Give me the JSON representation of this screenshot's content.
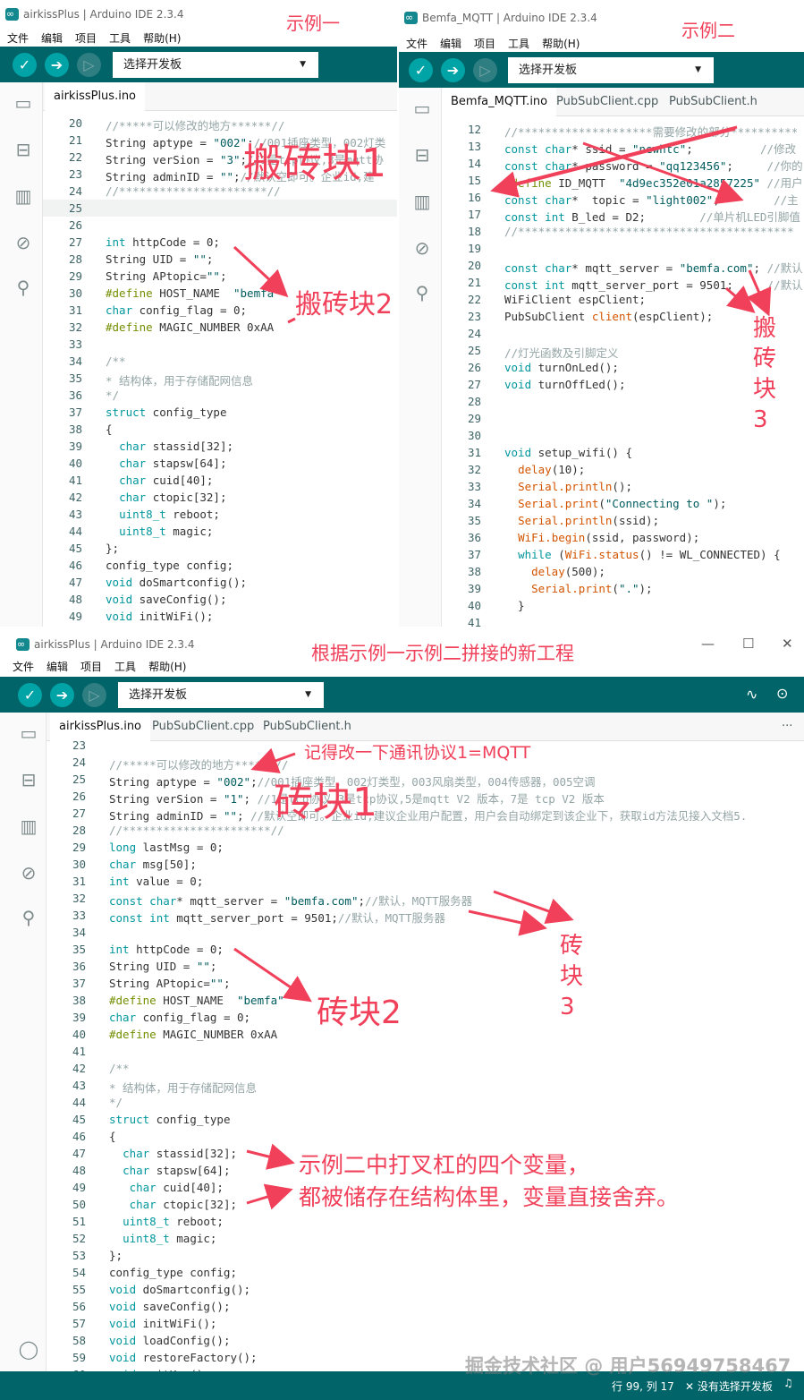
{
  "window1": {
    "title": "airkissPlus | Arduino IDE 2.3.4",
    "annotation": "示例一",
    "menus": [
      "文件",
      "编辑",
      "项目",
      "工具",
      "帮助(H)"
    ],
    "board_label": "选择开发板",
    "tabs": [
      "airkissPlus.ino"
    ],
    "lines": [
      {
        "n": "20",
        "t": "//*****可以修改的地方******//"
      },
      {
        "n": "21",
        "t": "String aptype = \"002\";//001插座类型，002灯类"
      },
      {
        "n": "22",
        "t": "String verSion = \"3\";//1是tcp协议,3是mqtt协"
      },
      {
        "n": "23",
        "t": "String adminID = \"\";//默认空即可。企业id,建"
      },
      {
        "n": "24",
        "t": "//**********************//"
      },
      {
        "n": "25",
        "t": ""
      },
      {
        "n": "26",
        "t": ""
      },
      {
        "n": "27",
        "t": "int httpCode = 0;"
      },
      {
        "n": "28",
        "t": "String UID = \"\";"
      },
      {
        "n": "29",
        "t": "String APtopic=\"\";"
      },
      {
        "n": "30",
        "t": "#define HOST_NAME  \"bemfa\""
      },
      {
        "n": "31",
        "t": "char config_flag = 0;"
      },
      {
        "n": "32",
        "t": "#define MAGIC_NUMBER 0xAA"
      },
      {
        "n": "33",
        "t": ""
      },
      {
        "n": "34",
        "t": "/**"
      },
      {
        "n": "35",
        "t": "* 结构体，用于存储配网信息"
      },
      {
        "n": "36",
        "t": "*/"
      },
      {
        "n": "37",
        "t": "struct config_type"
      },
      {
        "n": "38",
        "t": "{"
      },
      {
        "n": "39",
        "t": "  char stassid[32];"
      },
      {
        "n": "40",
        "t": "  char stapsw[64];"
      },
      {
        "n": "41",
        "t": "  char cuid[40];"
      },
      {
        "n": "42",
        "t": "  char ctopic[32];"
      },
      {
        "n": "43",
        "t": "  uint8_t reboot;"
      },
      {
        "n": "44",
        "t": "  uint8_t magic;"
      },
      {
        "n": "45",
        "t": "};"
      },
      {
        "n": "46",
        "t": "config_type config;"
      },
      {
        "n": "47",
        "t": "void doSmartconfig();"
      },
      {
        "n": "48",
        "t": "void saveConfig();"
      },
      {
        "n": "49",
        "t": "void initWiFi();"
      }
    ],
    "block1": "搬砖块1",
    "block2": "搬砖块2"
  },
  "window2": {
    "title": "Bemfa_MQTT | Arduino IDE 2.3.4",
    "annotation": "示例二",
    "menus": [
      "文件",
      "编辑",
      "项目",
      "工具",
      "帮助(H)"
    ],
    "board_label": "选择开发板",
    "tabs": [
      "Bemfa_MQTT.ino",
      "PubSubClient.cpp",
      "PubSubClient.h"
    ],
    "lines": [
      {
        "n": "12",
        "t": "//********************需要修改的部分**********"
      },
      {
        "n": "13",
        "t": "const char* ssid = \"newhtc\";          //修改"
      },
      {
        "n": "14",
        "t": "const char* password = \"qq123456\";     //你的"
      },
      {
        "n": "15",
        "t": "#define ID_MQTT  \"4d9ec352e01a2857225\" //用户"
      },
      {
        "n": "16",
        "t": "const char*  topic = \"light002\";        //主"
      },
      {
        "n": "17",
        "t": "const int B_led = D2;        //单片机LED引脚值"
      },
      {
        "n": "18",
        "t": "//*****************************************"
      },
      {
        "n": "19",
        "t": ""
      },
      {
        "n": "20",
        "t": "const char* mqtt_server = \"bemfa.com\"; //默认"
      },
      {
        "n": "21",
        "t": "const int mqtt_server_port = 9501;     //默认"
      },
      {
        "n": "22",
        "t": "WiFiClient espClient;"
      },
      {
        "n": "23",
        "t": "PubSubClient client(espClient);"
      },
      {
        "n": "24",
        "t": ""
      },
      {
        "n": "25",
        "t": "//灯光函数及引脚定义"
      },
      {
        "n": "26",
        "t": "void turnOnLed();"
      },
      {
        "n": "27",
        "t": "void turnOffLed();"
      },
      {
        "n": "28",
        "t": ""
      },
      {
        "n": "29",
        "t": ""
      },
      {
        "n": "30",
        "t": ""
      },
      {
        "n": "31",
        "t": "void setup_wifi() {"
      },
      {
        "n": "32",
        "t": "  delay(10);"
      },
      {
        "n": "33",
        "t": "  Serial.println();"
      },
      {
        "n": "34",
        "t": "  Serial.print(\"Connecting to \");"
      },
      {
        "n": "35",
        "t": "  Serial.println(ssid);"
      },
      {
        "n": "36",
        "t": "  WiFi.begin(ssid, password);"
      },
      {
        "n": "37",
        "t": "  while (WiFi.status() != WL_CONNECTED) {"
      },
      {
        "n": "38",
        "t": "    delay(500);"
      },
      {
        "n": "39",
        "t": "    Serial.print(\".\");"
      },
      {
        "n": "40",
        "t": "  }"
      },
      {
        "n": "41",
        "t": ""
      }
    ],
    "block3": [
      "搬",
      "砖",
      "块",
      "3"
    ]
  },
  "window3": {
    "title": "airkissPlus | Arduino IDE 2.3.4",
    "annotation": "根据示例一示例二拼接的新工程",
    "menus": [
      "文件",
      "编辑",
      "项目",
      "工具",
      "帮助(H)"
    ],
    "board_label": "选择开发板",
    "tabs": [
      "airkissPlus.ino",
      "PubSubClient.cpp",
      "PubSubClient.h"
    ],
    "more": "···",
    "lines": [
      {
        "n": "23",
        "t": ""
      },
      {
        "n": "24",
        "t": "//*****可以修改的地方******//"
      },
      {
        "n": "25",
        "t": "String aptype = \"002\";//001插座类型，002灯类型，003风扇类型，004传感器，005空调"
      },
      {
        "n": "26",
        "t": "String verSion = \"1\"; //1是tcp协议,3是tcp协议,5是mqtt V2 版本，7是 tcp V2 版本"
      },
      {
        "n": "27",
        "t": "String adminID = \"\"; //默认空即可。企业id,建议企业用户配置，用户会自动绑定到该企业下，获取id方法见接入文档5."
      },
      {
        "n": "28",
        "t": "//**********************//"
      },
      {
        "n": "29",
        "t": "long lastMsg = 0;"
      },
      {
        "n": "30",
        "t": "char msg[50];"
      },
      {
        "n": "31",
        "t": "int value = 0;"
      },
      {
        "n": "32",
        "t": "const char* mqtt_server = \"bemfa.com\";//默认，MQTT服务器"
      },
      {
        "n": "33",
        "t": "const int mqtt_server_port = 9501;//默认，MQTT服务器"
      },
      {
        "n": "34",
        "t": ""
      },
      {
        "n": "35",
        "t": "int httpCode = 0;"
      },
      {
        "n": "36",
        "t": "String UID = \"\";"
      },
      {
        "n": "37",
        "t": "String APtopic=\"\";"
      },
      {
        "n": "38",
        "t": "#define HOST_NAME  \"bemfa\""
      },
      {
        "n": "39",
        "t": "char config_flag = 0;"
      },
      {
        "n": "40",
        "t": "#define MAGIC_NUMBER 0xAA"
      },
      {
        "n": "41",
        "t": ""
      },
      {
        "n": "42",
        "t": "/**"
      },
      {
        "n": "43",
        "t": "* 结构体，用于存储配网信息"
      },
      {
        "n": "44",
        "t": "*/"
      },
      {
        "n": "45",
        "t": "struct config_type"
      },
      {
        "n": "46",
        "t": "{"
      },
      {
        "n": "47",
        "t": "  char stassid[32];"
      },
      {
        "n": "48",
        "t": "  char stapsw[64];"
      },
      {
        "n": "49",
        "t": "   char cuid[40];"
      },
      {
        "n": "50",
        "t": "   char ctopic[32];"
      },
      {
        "n": "51",
        "t": "  uint8_t reboot;"
      },
      {
        "n": "52",
        "t": "  uint8_t magic;"
      },
      {
        "n": "53",
        "t": "};"
      },
      {
        "n": "54",
        "t": "config_type config;"
      },
      {
        "n": "55",
        "t": "void doSmartconfig();"
      },
      {
        "n": "56",
        "t": "void saveConfig();"
      },
      {
        "n": "57",
        "t": "void initWiFi();"
      },
      {
        "n": "58",
        "t": "void loadConfig();"
      },
      {
        "n": "59",
        "t": "void restoreFactory();"
      },
      {
        "n": "60",
        "t": "void waitKey();"
      }
    ],
    "protocol_note": "记得改一下通讯协议1=MQTT",
    "block1": "砖块1",
    "block2": "砖块2",
    "block3": [
      "砖",
      "块",
      "3"
    ],
    "struct_note_1": "示例二中打叉杠的四个变量，",
    "struct_note_2": "都被储存在结构体里，变量直接舍弃。",
    "status_text": "行 99, 列 17",
    "status_board": "✕ 没有选择开发板",
    "watermark": "掘金技术社区 @ 用户56949758467"
  },
  "colors": {
    "accent": "#006468",
    "button": "#00a3a6",
    "annotation": "#f0405a",
    "keyword": "#00979d",
    "preprocessor": "#728e00",
    "function": "#d35400",
    "comment": "#95a5a6",
    "string": "#005c5f"
  },
  "icons": [
    "verify-icon",
    "upload-icon",
    "debugger-icon",
    "folder-icon",
    "boards-icon",
    "library-icon",
    "debug-icon",
    "search-icon",
    "serial-plotter-icon",
    "serial-monitor-icon",
    "account-icon",
    "bell-icon"
  ]
}
